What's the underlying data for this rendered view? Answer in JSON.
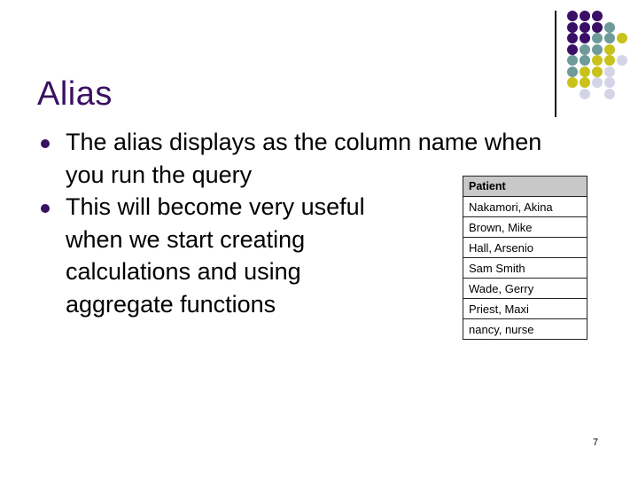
{
  "slide": {
    "title": "Alias",
    "bullets": [
      "The alias displays as the column name when\nyou run the query",
      "This will become very useful\nwhen we start creating\ncalculations and using\naggregate functions"
    ],
    "table": {
      "header": "Patient",
      "rows": [
        "Nakamori, Akina",
        "Brown, Mike",
        "Hall, Arsenio",
        "Sam Smith",
        "Wade, Gerry",
        "Priest, Maxi",
        "nancy, nurse"
      ]
    },
    "page_number": "7"
  },
  "theme": {
    "title_color": "#3a1063",
    "bullet_color": "#3a1063",
    "dot_colors": {
      "P": "#3a0e66",
      "T": "#6e9a9a",
      "Y": "#c8c21a",
      "L": "#d4d4e8"
    },
    "dot_pattern": [
      "PPP",
      "PPPT",
      "PPTTY",
      "PTTY",
      "TTYYL",
      "TYYL",
      "YYLL",
      ".L.L"
    ]
  }
}
